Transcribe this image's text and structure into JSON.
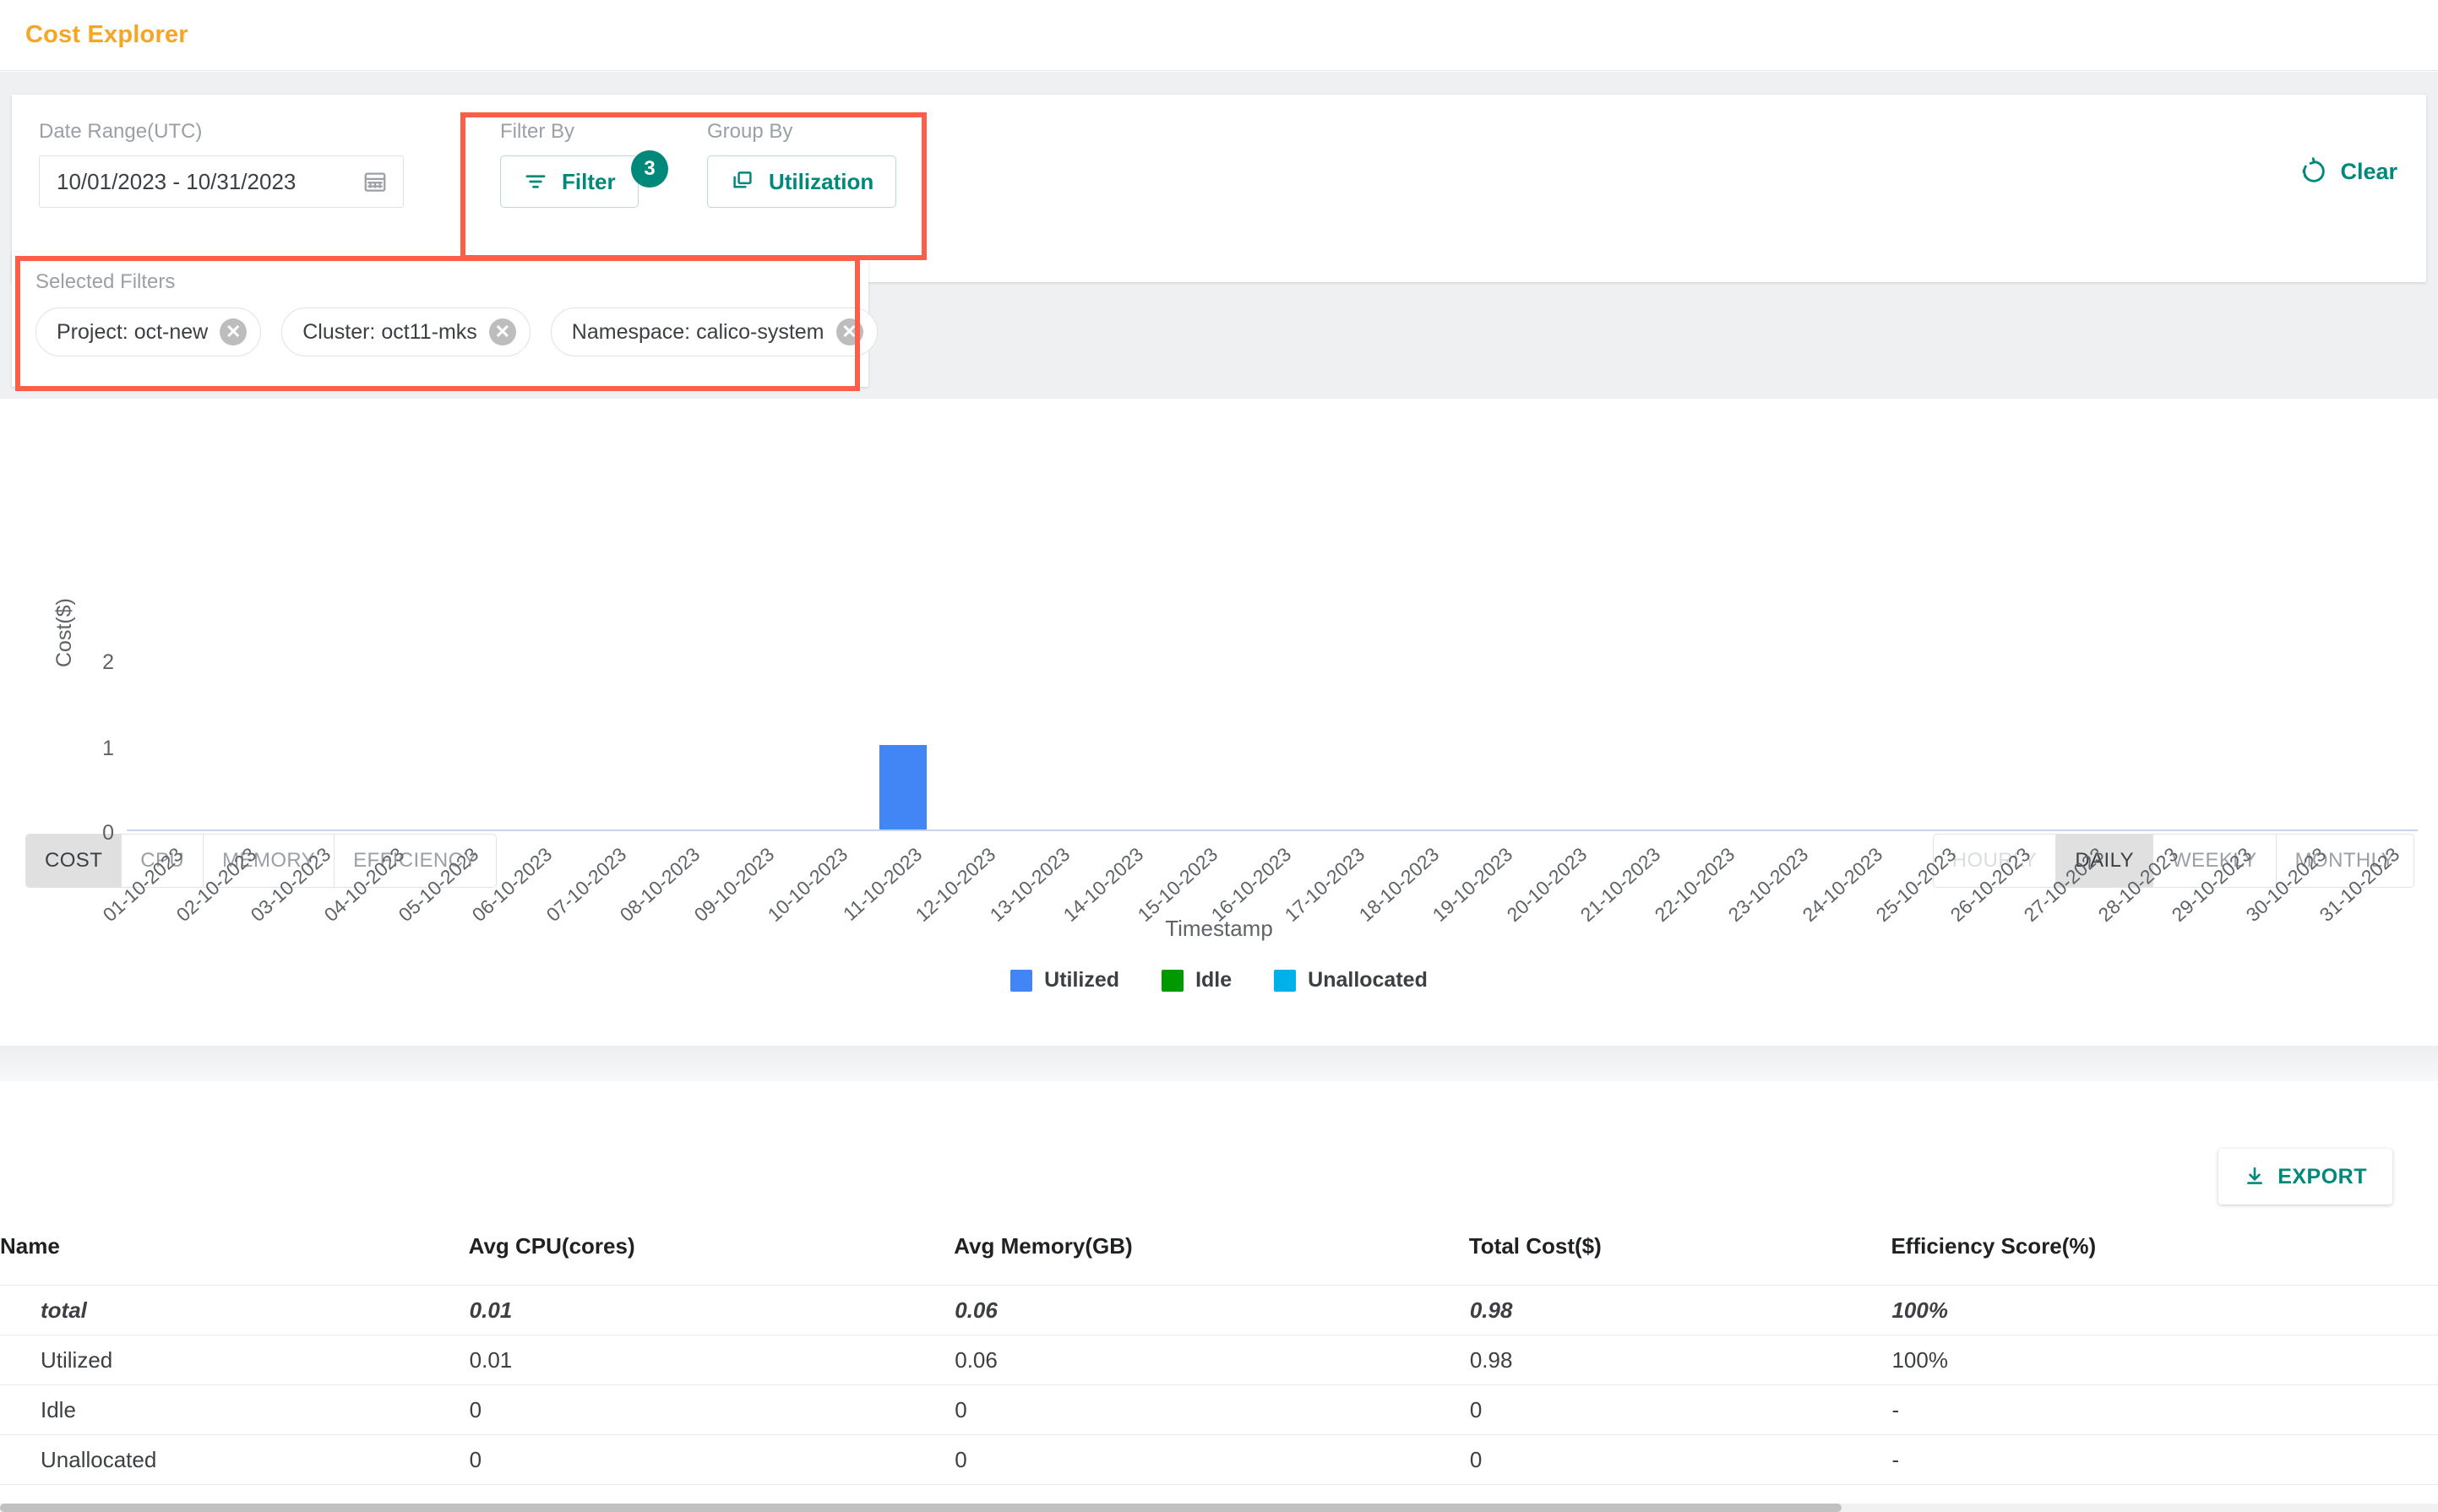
{
  "header": {
    "title": "Cost Explorer"
  },
  "filters": {
    "date_range_label": "Date Range(UTC)",
    "date_range_value": "10/01/2023  -  10/31/2023",
    "calendar_icon": "calendar-icon",
    "filter_by_label": "Filter By",
    "filter_button_label": "Filter",
    "filter_badge_count": "3",
    "group_by_label": "Group By",
    "group_by_value": "Utilization",
    "clear_label": "Clear"
  },
  "selected_filters": {
    "title": "Selected Filters",
    "chips": [
      {
        "label": "Project: oct-new",
        "remove": "✕"
      },
      {
        "label": "Cluster: oct11-mks",
        "remove": "✕"
      },
      {
        "label": "Namespace: calico-system",
        "remove": "✕"
      }
    ]
  },
  "metric_tabs": [
    {
      "label": "COST",
      "state": "active"
    },
    {
      "label": "CPU",
      "state": "normal"
    },
    {
      "label": "MEMORY",
      "state": "normal"
    },
    {
      "label": "EFFICIENCY",
      "state": "normal"
    }
  ],
  "granularity_tabs": [
    {
      "label": "HOURLY",
      "state": "disabled"
    },
    {
      "label": "DAILY",
      "state": "active"
    },
    {
      "label": "WEEKLY",
      "state": "normal"
    },
    {
      "label": "MONTHLY",
      "state": "normal"
    }
  ],
  "chart_data": {
    "type": "bar",
    "title": "",
    "xlabel": "Timestamp",
    "ylabel": "Cost($)",
    "ylim": [
      0,
      2
    ],
    "yticks": [
      "0",
      "1",
      "2"
    ],
    "grid": false,
    "legend_position": "bottom",
    "categories": [
      "01-10-2023",
      "02-10-2023",
      "03-10-2023",
      "04-10-2023",
      "05-10-2023",
      "06-10-2023",
      "07-10-2023",
      "08-10-2023",
      "09-10-2023",
      "10-10-2023",
      "11-10-2023",
      "12-10-2023",
      "13-10-2023",
      "14-10-2023",
      "15-10-2023",
      "16-10-2023",
      "17-10-2023",
      "18-10-2023",
      "19-10-2023",
      "20-10-2023",
      "21-10-2023",
      "22-10-2023",
      "23-10-2023",
      "24-10-2023",
      "25-10-2023",
      "26-10-2023",
      "27-10-2023",
      "28-10-2023",
      "29-10-2023",
      "30-10-2023",
      "31-10-2023"
    ],
    "series": [
      {
        "name": "Utilized",
        "color": "#4285f4",
        "values": [
          0,
          0,
          0,
          0,
          0,
          0,
          0,
          0,
          0,
          0,
          0.98,
          0,
          0,
          0,
          0,
          0,
          0,
          0,
          0,
          0,
          0,
          0,
          0,
          0,
          0,
          0,
          0,
          0,
          0,
          0,
          0
        ]
      },
      {
        "name": "Idle",
        "color": "#009900",
        "values": [
          0,
          0,
          0,
          0,
          0,
          0,
          0,
          0,
          0,
          0,
          0,
          0,
          0,
          0,
          0,
          0,
          0,
          0,
          0,
          0,
          0,
          0,
          0,
          0,
          0,
          0,
          0,
          0,
          0,
          0,
          0
        ]
      },
      {
        "name": "Unallocated",
        "color": "#00b0e8",
        "values": [
          0,
          0,
          0,
          0,
          0,
          0,
          0,
          0,
          0,
          0,
          0,
          0,
          0,
          0,
          0,
          0,
          0,
          0,
          0,
          0,
          0,
          0,
          0,
          0,
          0,
          0,
          0,
          0,
          0,
          0,
          0
        ]
      }
    ]
  },
  "table": {
    "export_label": "EXPORT",
    "columns": [
      "Name",
      "Avg CPU(cores)",
      "Avg Memory(GB)",
      "Total Cost($)",
      "Efficiency Score(%)"
    ],
    "rows": [
      {
        "name": "total",
        "cpu": "0.01",
        "memory": "0.06",
        "cost": "0.98",
        "efficiency": "100%",
        "emphasis": true
      },
      {
        "name": "Utilized",
        "cpu": "0.01",
        "memory": "0.06",
        "cost": "0.98",
        "efficiency": "100%",
        "emphasis": false
      },
      {
        "name": "Idle",
        "cpu": "0",
        "memory": "0",
        "cost": "0",
        "efficiency": "-",
        "emphasis": false
      },
      {
        "name": "Unallocated",
        "cpu": "0",
        "memory": "0",
        "cost": "0",
        "efficiency": "-",
        "emphasis": false
      }
    ]
  },
  "colors": {
    "accent_teal": "#00897b",
    "title_orange": "#f5a623",
    "annotation_red": "#fc5e4a",
    "bar_blue": "#4285f4"
  }
}
